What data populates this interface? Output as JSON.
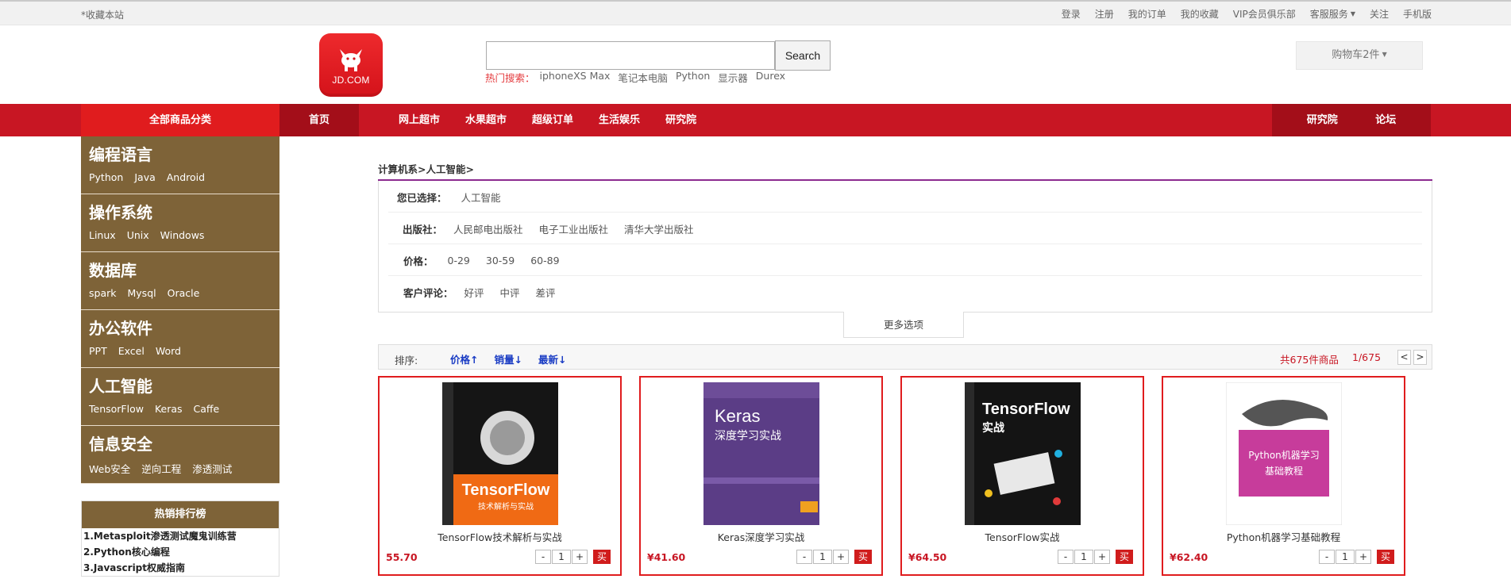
{
  "topbar": {
    "favorite": "*收藏本站",
    "links": [
      "登录",
      "注册",
      "我的订单",
      "我的收藏",
      "VIP会员俱乐部",
      "客服服务",
      "关注",
      "手机版"
    ]
  },
  "header": {
    "logo_text": "JD.COM",
    "search_placeholder": "",
    "search_button": "Search",
    "hot_label": "热门搜索：",
    "hot_items": [
      "iphoneXS Max",
      "笔记本电脑",
      "Python",
      "显示器",
      "Durex"
    ],
    "cart": "购物车2件"
  },
  "nav": {
    "all_categories": "全部商品分类",
    "home": "首页",
    "items": [
      "网上超市",
      "水果超市",
      "超级订单",
      "生活娱乐",
      "研究院"
    ],
    "right_items": [
      "研究院",
      "论坛"
    ]
  },
  "categories": [
    {
      "title": "编程语言",
      "subs": [
        "Python",
        "Java",
        "Android"
      ]
    },
    {
      "title": "操作系统",
      "subs": [
        "Linux",
        "Unix",
        "Windows"
      ]
    },
    {
      "title": "数据库",
      "subs": [
        "spark",
        "Mysql",
        "Oracle"
      ]
    },
    {
      "title": "办公软件",
      "subs": [
        "PPT",
        "Excel",
        "Word"
      ]
    },
    {
      "title": "人工智能",
      "subs": [
        "TensorFlow",
        "Keras",
        "Caffe"
      ]
    },
    {
      "title": "信息安全",
      "subs": [
        "Web安全",
        "逆向工程",
        "渗透测试"
      ]
    }
  ],
  "ranking": {
    "title": "热销排行榜",
    "items": [
      "1.Metasploit渗透测试魔鬼训练营",
      "2.Python核心编程",
      "3.Javascript权威指南"
    ]
  },
  "filters": {
    "breadcrumb": "计算机系>人工智能>",
    "selected_label": "您已选择：",
    "selected_value": "人工智能",
    "rows": [
      {
        "label": "出版社：",
        "values": [
          "人民邮电出版社",
          "电子工业出版社",
          "清华大学出版社"
        ]
      },
      {
        "label": "价格：",
        "values": [
          "0-29",
          "30-59",
          "60-89"
        ]
      },
      {
        "label": "客户评论：",
        "values": [
          "好评",
          "中评",
          "差评"
        ]
      }
    ],
    "more": "更多选项"
  },
  "sort": {
    "label": "排序:",
    "options": [
      "价格↑",
      "销量↓",
      "最新↓"
    ],
    "total": "共675件商品",
    "page": "1/675",
    "prev": "<",
    "next": ">"
  },
  "products": [
    {
      "name": "TensorFlow技术解析与实战",
      "price": "55.70",
      "qty": "1",
      "buy": "买",
      "cover_color": "#111111"
    },
    {
      "name": "Keras深度学习实战",
      "price": "¥41.60",
      "qty": "1",
      "buy": "买",
      "cover_color": "#5b3d86"
    },
    {
      "name": "TensorFlow实战",
      "price": "¥64.50",
      "qty": "1",
      "buy": "买",
      "cover_color": "#151515"
    },
    {
      "name": "Python机器学习基础教程",
      "price": "¥62.40",
      "qty": "1",
      "buy": "买",
      "cover_color": "#c73c9b"
    }
  ],
  "covers": {
    "tf1_title": "TensorFlow",
    "tf1_sub": "技术解析与实战",
    "keras_title": "Keras",
    "keras_sub": "深度学习实战",
    "tf2_title": "TensorFlow",
    "tf2_sub": "实战",
    "py_title": "Python机器学习",
    "py_sub": "基础教程"
  }
}
